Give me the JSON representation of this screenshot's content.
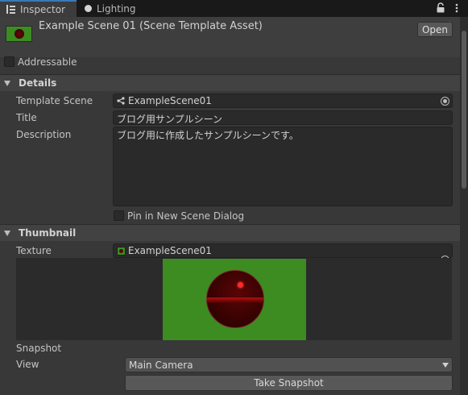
{
  "tabs": [
    {
      "label": "Inspector",
      "icon": "inspector-icon",
      "active": true
    },
    {
      "label": "Lighting",
      "icon": "bulb-icon",
      "active": false
    }
  ],
  "header": {
    "title": "Example Scene 01 (Scene Template Asset)",
    "open_label": "Open",
    "thumbnail_icon": "scene-thumbnail-icon"
  },
  "addressable": {
    "label": "Addressable",
    "checked": false
  },
  "details": {
    "title": "Details",
    "template_scene_label": "Template Scene",
    "template_scene_value": "ExampleScene01",
    "title_label": "Title",
    "title_value": "ブログ用サンプルシーン",
    "description_label": "Description",
    "description_value": "ブログ用に作成したサンプルシーンです。",
    "pin_label": "Pin in New Scene Dialog",
    "pin_checked": false
  },
  "thumbnail": {
    "title": "Thumbnail",
    "texture_label": "Texture",
    "texture_value": "ExampleScene01",
    "snapshot_label": "Snapshot",
    "view_label": "View",
    "view_value": "Main Camera",
    "take_snapshot_label": "Take Snapshot"
  },
  "colors": {
    "accent": "#3a79bb",
    "thumbnail_bg": "#3c8c21",
    "sphere": "#5a0505"
  }
}
